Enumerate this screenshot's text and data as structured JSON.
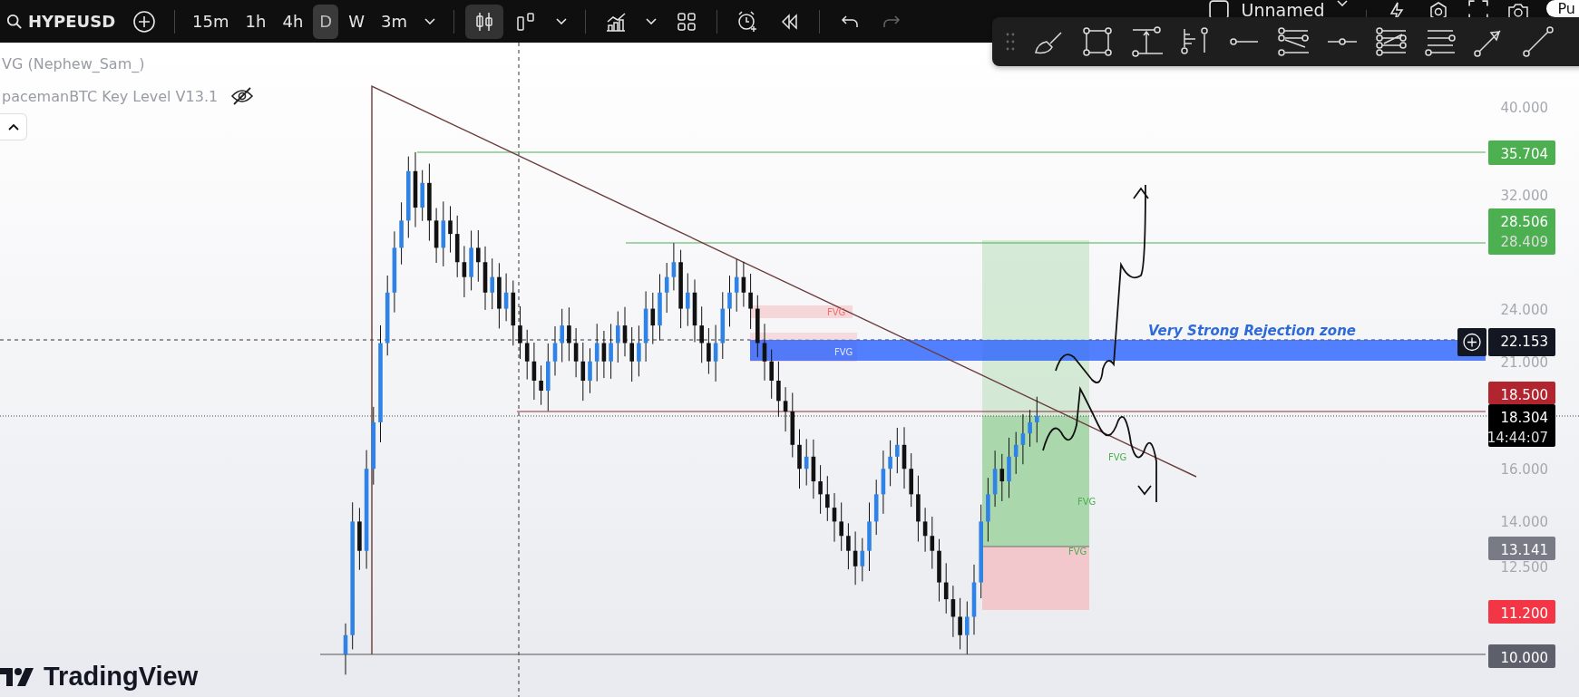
{
  "toolbar": {
    "symbol": "HYPEUSD",
    "intervals": [
      {
        "label": "15m",
        "selected": false
      },
      {
        "label": "1h",
        "selected": false
      },
      {
        "label": "4h",
        "selected": false
      },
      {
        "label": "D",
        "selected": true
      },
      {
        "label": "W",
        "selected": false
      },
      {
        "label": "3m",
        "selected": false
      }
    ],
    "layout_name": "Unnamed",
    "publish_label": "Pu"
  },
  "legend": {
    "indicators": [
      {
        "name": "VG (Nephew_Sam_)",
        "hidden": false
      },
      {
        "name": "pacemanBTC Key Level V13.1",
        "hidden": true
      }
    ]
  },
  "chart": {
    "annotation": "Very Strong Rejection zone",
    "fvg_labels": [
      {
        "text": "FVG",
        "color": "#f26d6d"
      },
      {
        "text": "FVG",
        "color": "#dfe5ff"
      },
      {
        "text": "FVG",
        "color": "#4caf50"
      },
      {
        "text": "FVG",
        "color": "#4caf50"
      },
      {
        "text": "FVG",
        "color": "#4caf50"
      }
    ],
    "price_ticks": [
      "40.000",
      "32.000",
      "24.000",
      "21.000",
      "16.000",
      "14.000",
      "12.500"
    ],
    "price_labels": [
      {
        "lines": [
          "35.704"
        ],
        "color": "#4caf50",
        "kind": "plain"
      },
      {
        "lines": [
          "28.506",
          "28.409"
        ],
        "color": "#4caf50",
        "kind": "plain"
      },
      {
        "lines": [
          "22.153"
        ],
        "color": "#131722",
        "kind": "crosshair"
      },
      {
        "lines": [
          "18.500"
        ],
        "color": "#b2242e",
        "kind": "plain"
      },
      {
        "lines": [
          "18.304",
          "14:44:07"
        ],
        "color": "#000000",
        "kind": "plain"
      },
      {
        "lines": [
          "13.141"
        ],
        "color": "#787b86",
        "kind": "plain"
      },
      {
        "lines": [
          "11.200"
        ],
        "color": "#f23645",
        "kind": "plain"
      },
      {
        "lines": [
          "10.000"
        ],
        "color": "#5d606b",
        "kind": "plain"
      }
    ]
  },
  "logo": "TradingView"
}
